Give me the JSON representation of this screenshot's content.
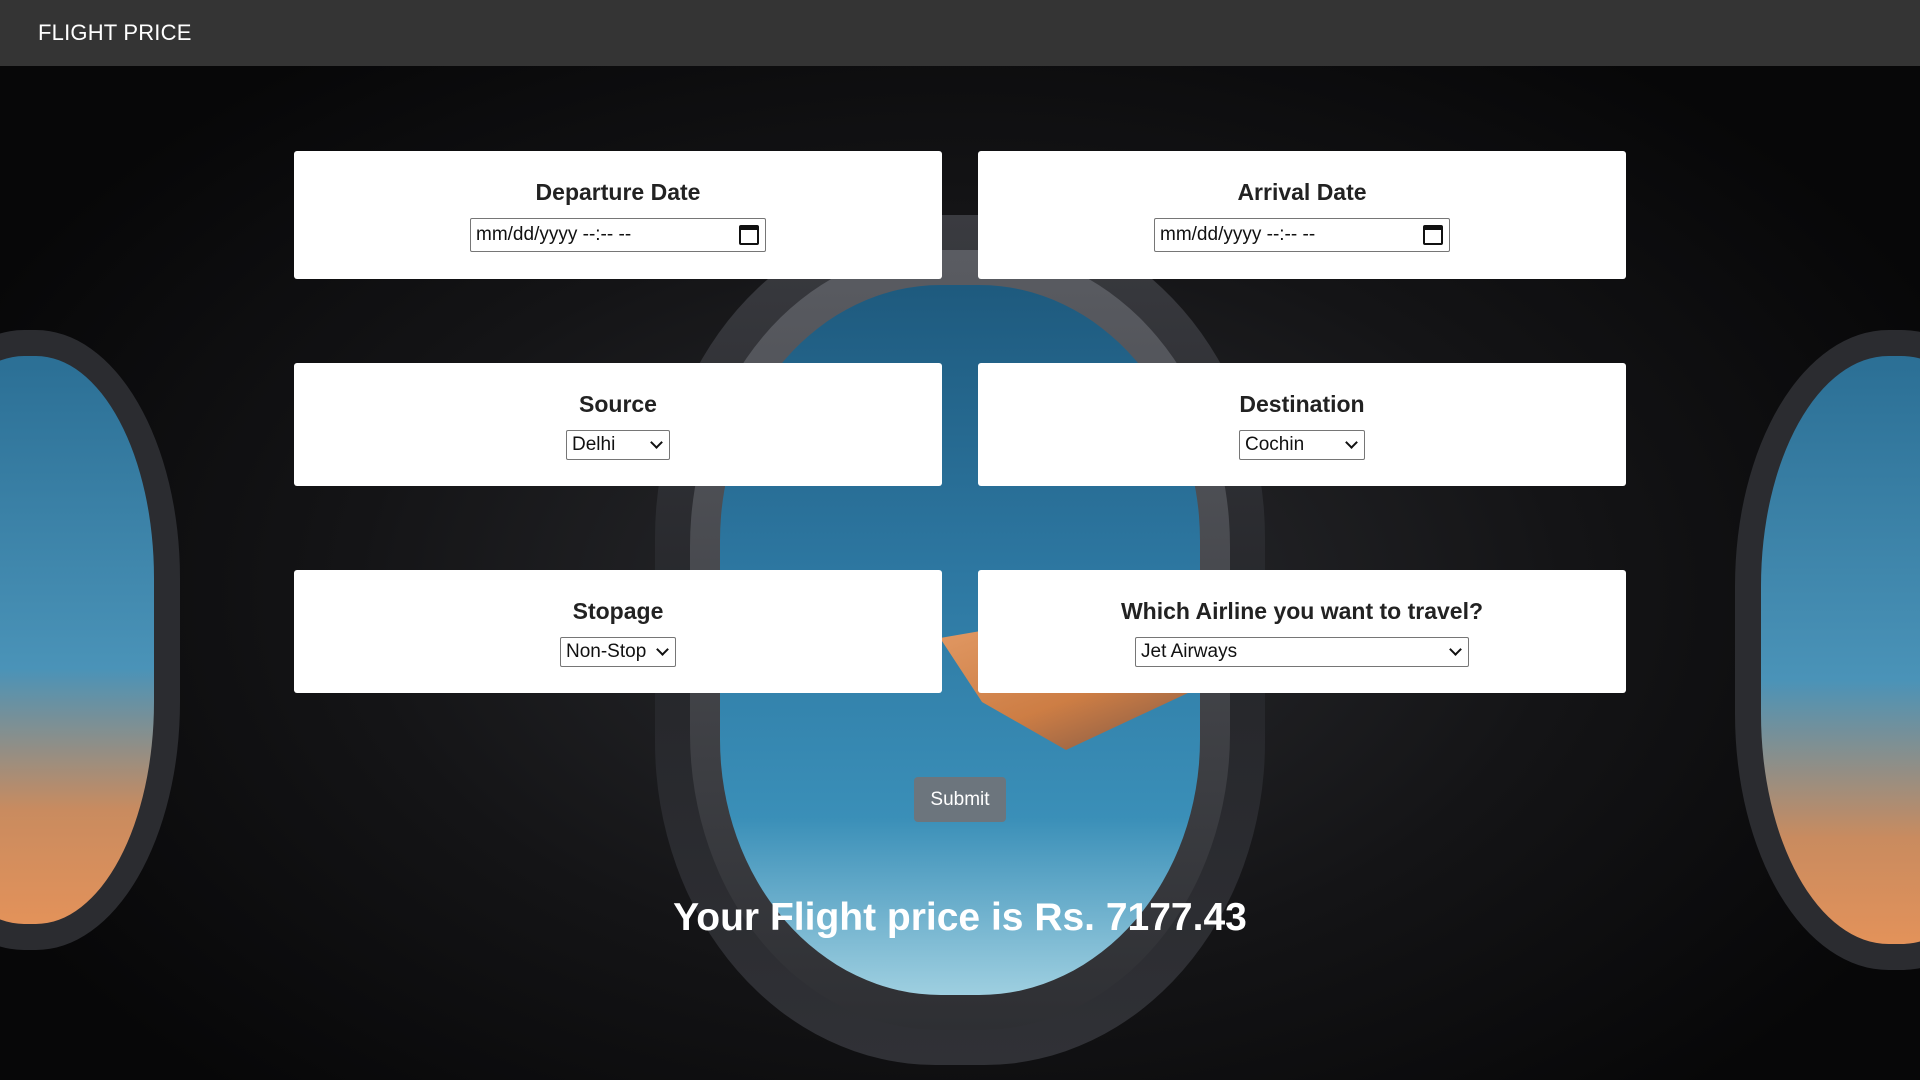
{
  "navbar": {
    "brand": "FLIGHT PRICE"
  },
  "departure": {
    "label": "Departure Date",
    "value": "mm/dd/yyyy --:-- --",
    "icon": "calendar-icon"
  },
  "arrival": {
    "label": "Arrival Date",
    "value": "mm/dd/yyyy --:-- --",
    "icon": "calendar-icon"
  },
  "source": {
    "label": "Source",
    "selected": "Delhi"
  },
  "destination": {
    "label": "Destination",
    "selected": "Cochin"
  },
  "stopage": {
    "label": "Stopage",
    "selected": "Non-Stop"
  },
  "airline": {
    "label": "Which Airline you want to travel?",
    "selected": "Jet Airways"
  },
  "submit": {
    "label": "Submit"
  },
  "result": {
    "text": "Your Flight price is Rs. 7177.43"
  },
  "colors": {
    "navbar": "#343434",
    "submit": "#6c757d",
    "card": "#ffffff"
  }
}
